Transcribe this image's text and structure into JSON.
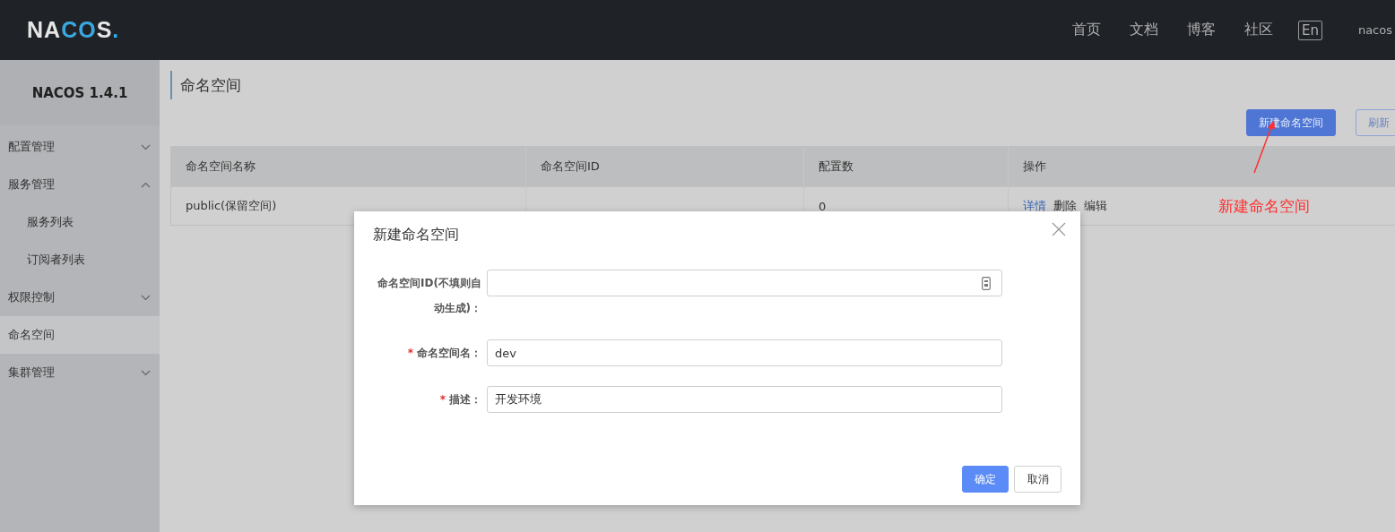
{
  "header": {
    "logo": "NACOS.",
    "nav": [
      "首页",
      "文档",
      "博客",
      "社区"
    ],
    "language_button": "En",
    "user": "nacos"
  },
  "sidebar": {
    "title": "NACOS 1.4.1",
    "items": [
      {
        "label": "配置管理",
        "expanded": false,
        "selected": false
      },
      {
        "label": "服务管理",
        "expanded": true,
        "selected": false,
        "children": [
          {
            "label": "服务列表",
            "selected": false
          },
          {
            "label": "订阅者列表",
            "selected": false
          }
        ]
      },
      {
        "label": "权限控制",
        "expanded": false,
        "selected": false
      },
      {
        "label": "命名空间",
        "selected": true
      },
      {
        "label": "集群管理",
        "expanded": false,
        "selected": false
      }
    ]
  },
  "page": {
    "title": "命名空间",
    "buttons": [
      {
        "label": "新建命名空间",
        "kind": "primary"
      },
      {
        "label": "刷新",
        "kind": "secondary"
      }
    ]
  },
  "table": {
    "columns": [
      "命名空间名称",
      "命名空间ID",
      "配置数",
      "操作"
    ],
    "rows": [
      {
        "cells": [
          "public(保留空间)",
          "",
          "0"
        ],
        "actions": [
          "详情",
          "删除",
          "编辑"
        ]
      }
    ]
  },
  "annotation": {
    "text": "新建命名空间"
  },
  "dialog": {
    "title": "新建命名空间",
    "required_mark": "*",
    "fields": [
      {
        "label": "命名空间ID(不填则自动生成)：",
        "required": false
      },
      {
        "label": "命名空间名：",
        "required": true,
        "value": "dev"
      },
      {
        "label": "描述：",
        "required": true,
        "value": "开发环境"
      }
    ],
    "buttons": [
      {
        "label": "确定",
        "kind": "primary"
      },
      {
        "label": "取消",
        "kind": "secondary"
      }
    ]
  }
}
